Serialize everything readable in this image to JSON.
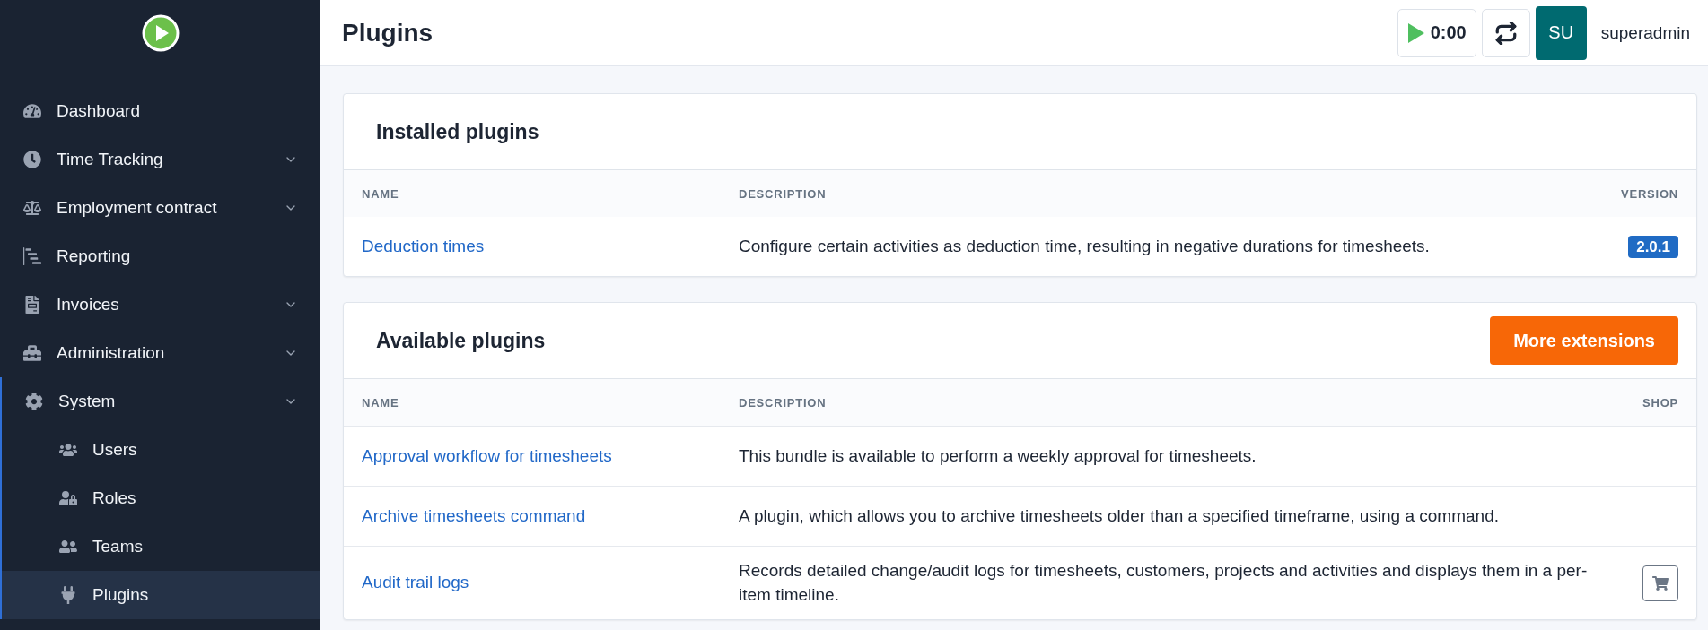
{
  "sidebar": {
    "items": [
      {
        "label": "Dashboard",
        "submenu": false,
        "selected": false
      },
      {
        "label": "Time Tracking",
        "submenu": true,
        "selected": false
      },
      {
        "label": "Employment contract",
        "submenu": true,
        "selected": false
      },
      {
        "label": "Reporting",
        "submenu": false,
        "selected": false
      },
      {
        "label": "Invoices",
        "submenu": true,
        "selected": false
      },
      {
        "label": "Administration",
        "submenu": true,
        "selected": false
      },
      {
        "label": "System",
        "submenu": true,
        "selected": false,
        "children": [
          {
            "label": "Users",
            "selected": false
          },
          {
            "label": "Roles",
            "selected": false
          },
          {
            "label": "Teams",
            "selected": false
          },
          {
            "label": "Plugins",
            "selected": true
          }
        ]
      }
    ]
  },
  "header": {
    "title": "Plugins",
    "timer": "0:00",
    "avatar": "SU",
    "username": "superadmin"
  },
  "installed": {
    "title": "Installed plugins",
    "columns": [
      "NAME",
      "DESCRIPTION",
      "VERSION"
    ],
    "rows": [
      {
        "name": "Deduction times",
        "description": "Configure certain activities as deduction time, resulting in negative durations for timesheets.",
        "version": "2.0.1"
      }
    ]
  },
  "available": {
    "title": "Available plugins",
    "button": "More extensions",
    "columns": [
      "NAME",
      "DESCRIPTION",
      "SHOP"
    ],
    "rows": [
      {
        "name": "Approval workflow for timesheets",
        "description": "This bundle is available to perform a weekly approval for timesheets.",
        "shop": false
      },
      {
        "name": "Archive timesheets command",
        "description": "A plugin, which allows you to archive timesheets older than a specified timeframe, using a command.",
        "shop": false
      },
      {
        "name": "Audit trail logs",
        "description": "Records detailed change/audit logs for timesheets, customers, projects and activities and displays them in a per-item timeline.",
        "shop": true
      }
    ]
  }
}
